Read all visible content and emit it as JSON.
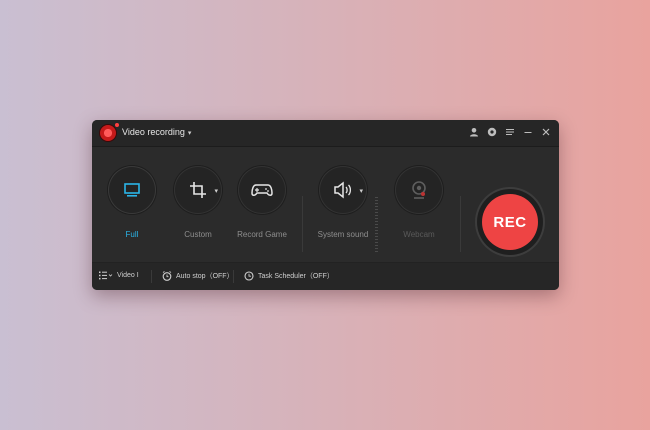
{
  "titlebar": {
    "mode_label": "Video recording",
    "mode_caret": "▾",
    "icons": [
      "account-icon",
      "settings-icon",
      "menu-icon",
      "minimize-icon",
      "close-icon"
    ]
  },
  "tools": [
    {
      "label": "Full",
      "icon": "monitor-icon",
      "state": "active"
    },
    {
      "label": "Custom",
      "icon": "crop-icon",
      "state": "normal",
      "has_dropdown": true
    },
    {
      "label": "Record Game",
      "icon": "gamepad-icon",
      "state": "normal"
    },
    {
      "label": "System sound",
      "icon": "speaker-icon",
      "state": "normal",
      "has_dropdown": true
    },
    {
      "label": "Webcam",
      "icon": "webcam-icon",
      "state": "disabled"
    }
  ],
  "rec_button": {
    "label": "REC",
    "color": "#ee4444"
  },
  "bottom": {
    "output": "Video I",
    "auto_stop": "Auto stop（OFF）",
    "task_scheduler": "Task Scheduler（OFF）"
  },
  "colors": {
    "accent": "#2bb5e8",
    "rec": "#ee4444",
    "window_bg": "#2b2b2b"
  }
}
